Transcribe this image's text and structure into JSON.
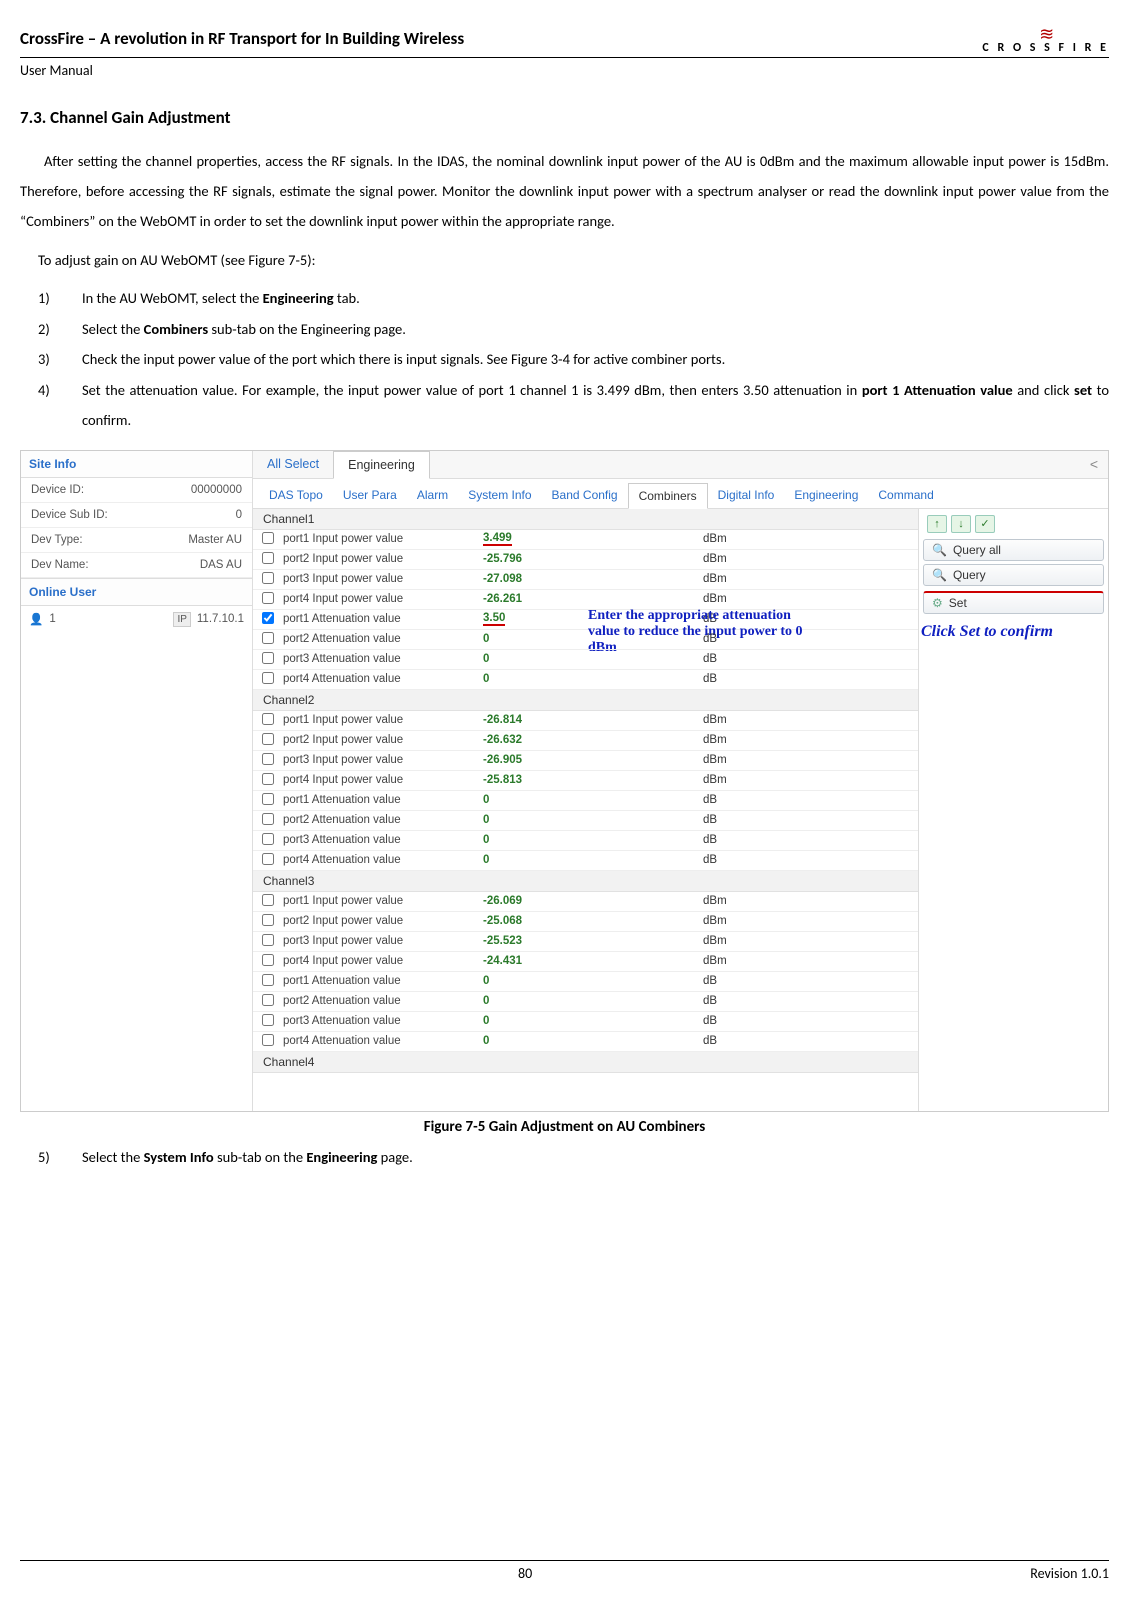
{
  "header": {
    "title": "CrossFire – A revolution in RF Transport for In Building Wireless",
    "subtitle": "User Manual",
    "logo_text": "C R O S S F I R E"
  },
  "section": {
    "title": "7.3. Channel Gain Adjustment",
    "paragraph": "After setting the channel properties, access the RF signals. In the IDAS, the nominal downlink input power of the AU is 0dBm and the maximum allowable input power is 15dBm. Therefore, before accessing the RF signals, estimate the signal power. Monitor the downlink input power with a spectrum analyser or read the downlink input power value from the “Combiners” on the WebOMT in order to set the downlink input power within the appropriate range.",
    "intro": "To adjust gain on AU WebOMT (see Figure 7-5):",
    "steps": {
      "s1_a": "In the AU WebOMT, select the ",
      "s1_b": "Engineering",
      "s1_c": " tab.",
      "s2_a": "Select the ",
      "s2_b": "Combiners",
      "s2_c": " sub-tab on the Engineering page.",
      "s3": "Check the input power value of the port which there is input signals. See Figure 3-4 for active combiner ports.",
      "s4_a": "Set the attenuation value. For example, the input power value of port 1 channel 1 is 3.499 dBm, then enters 3.50 attenuation in ",
      "s4_b": "port 1 Attenuation value",
      "s4_c": " and click ",
      "s4_d": "set",
      "s4_e": " to confirm.",
      "s5_a": "Select the ",
      "s5_b": "System Info",
      "s5_c": " sub-tab on the ",
      "s5_d": "Engineering",
      "s5_e": " page."
    },
    "caption": "Figure 7-5 Gain Adjustment on AU Combiners"
  },
  "sidebar": {
    "site_info_title": "Site Info",
    "device_id_label": "Device ID:",
    "device_id_value": "00000000",
    "device_sub_label": "Device Sub ID:",
    "device_sub_value": "0",
    "dev_type_label": "Dev Type:",
    "dev_type_value": "Master AU",
    "dev_name_label": "Dev Name:",
    "dev_name_value": "DAS AU",
    "online_title": "Online User",
    "online_num": "1",
    "online_ip_label": "IP",
    "online_ip": "11.7.10.1"
  },
  "tabs1": {
    "all_select": "All Select",
    "engineering": "Engineering"
  },
  "tabs2": {
    "das": "DAS Topo",
    "user": "User Para",
    "alarm": "Alarm",
    "sys": "System Info",
    "band": "Band Config",
    "comb": "Combiners",
    "dig": "Digital Info",
    "eng": "Engineering",
    "cmd": "Command"
  },
  "actions": {
    "query_all": "Query all",
    "query": "Query",
    "set": "Set"
  },
  "annotations": {
    "enter": "Enter the appropriate attenuation value to reduce the input power to 0 dBm",
    "click_set": "Click Set to confirm"
  },
  "channels": [
    {
      "name": "Channel1",
      "rows": [
        {
          "label": "port1 Input power value",
          "value": "3.499",
          "unit": "dBm",
          "checked": false,
          "hl": true
        },
        {
          "label": "port2 Input power value",
          "value": "-25.796",
          "unit": "dBm",
          "checked": false
        },
        {
          "label": "port3 Input power value",
          "value": "-27.098",
          "unit": "dBm",
          "checked": false
        },
        {
          "label": "port4 Input power value",
          "value": "-26.261",
          "unit": "dBm",
          "checked": false
        },
        {
          "label": "port1 Attenuation value",
          "value": "3.50",
          "unit": "dB",
          "checked": true,
          "hl": true,
          "anno": true
        },
        {
          "label": "port2 Attenuation value",
          "value": "0",
          "unit": "dB",
          "checked": false
        },
        {
          "label": "port3 Attenuation value",
          "value": "0",
          "unit": "dB",
          "checked": false
        },
        {
          "label": "port4 Attenuation value",
          "value": "0",
          "unit": "dB",
          "checked": false
        }
      ]
    },
    {
      "name": "Channel2",
      "rows": [
        {
          "label": "port1 Input power value",
          "value": "-26.814",
          "unit": "dBm",
          "checked": false
        },
        {
          "label": "port2 Input power value",
          "value": "-26.632",
          "unit": "dBm",
          "checked": false
        },
        {
          "label": "port3 Input power value",
          "value": "-26.905",
          "unit": "dBm",
          "checked": false
        },
        {
          "label": "port4 Input power value",
          "value": "-25.813",
          "unit": "dBm",
          "checked": false
        },
        {
          "label": "port1 Attenuation value",
          "value": "0",
          "unit": "dB",
          "checked": false
        },
        {
          "label": "port2 Attenuation value",
          "value": "0",
          "unit": "dB",
          "checked": false
        },
        {
          "label": "port3 Attenuation value",
          "value": "0",
          "unit": "dB",
          "checked": false
        },
        {
          "label": "port4 Attenuation value",
          "value": "0",
          "unit": "dB",
          "checked": false
        }
      ]
    },
    {
      "name": "Channel3",
      "rows": [
        {
          "label": "port1 Input power value",
          "value": "-26.069",
          "unit": "dBm",
          "checked": false
        },
        {
          "label": "port2 Input power value",
          "value": "-25.068",
          "unit": "dBm",
          "checked": false
        },
        {
          "label": "port3 Input power value",
          "value": "-25.523",
          "unit": "dBm",
          "checked": false
        },
        {
          "label": "port4 Input power value",
          "value": "-24.431",
          "unit": "dBm",
          "checked": false
        },
        {
          "label": "port1 Attenuation value",
          "value": "0",
          "unit": "dB",
          "checked": false
        },
        {
          "label": "port2 Attenuation value",
          "value": "0",
          "unit": "dB",
          "checked": false
        },
        {
          "label": "port3 Attenuation value",
          "value": "0",
          "unit": "dB",
          "checked": false
        },
        {
          "label": "port4 Attenuation value",
          "value": "0",
          "unit": "dB",
          "checked": false
        }
      ]
    },
    {
      "name": "Channel4",
      "rows": []
    }
  ],
  "footer": {
    "page": "80",
    "rev": "Revision 1.0.1"
  }
}
